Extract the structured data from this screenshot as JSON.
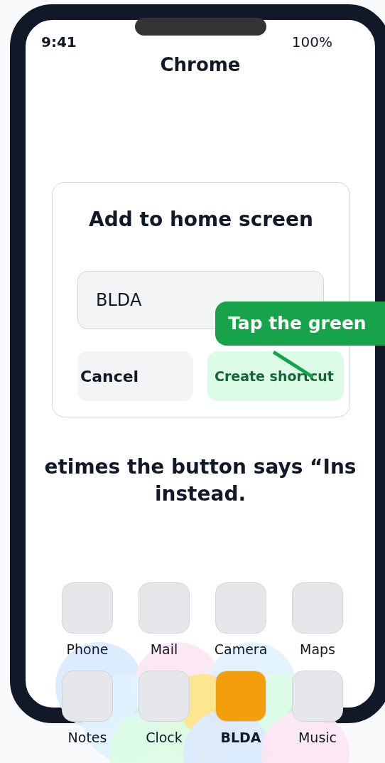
{
  "status_bar": {
    "time": "9:41",
    "battery": "100%"
  },
  "app_title": "Chrome",
  "dialog": {
    "title": "Add to home screen",
    "name_field": {
      "value": "BLDA"
    },
    "buttons": [
      {
        "label": "Cancel",
        "kind": "secondary"
      },
      {
        "label": "Create shortcut",
        "kind": "primary"
      }
    ]
  },
  "tooltip": {
    "text": "Tap the green"
  },
  "hint_lines": [
    "etimes the button says “Ins",
    "instead."
  ],
  "apps": [
    {
      "label": "Phone",
      "highlighted": false
    },
    {
      "label": "Mail",
      "highlighted": false
    },
    {
      "label": "Camera",
      "highlighted": false
    },
    {
      "label": "Maps",
      "highlighted": false
    },
    {
      "label": "Notes",
      "highlighted": false
    },
    {
      "label": "Clock",
      "highlighted": false
    },
    {
      "label": "BLDA",
      "highlighted": true
    },
    {
      "label": "Music",
      "highlighted": false
    }
  ]
}
